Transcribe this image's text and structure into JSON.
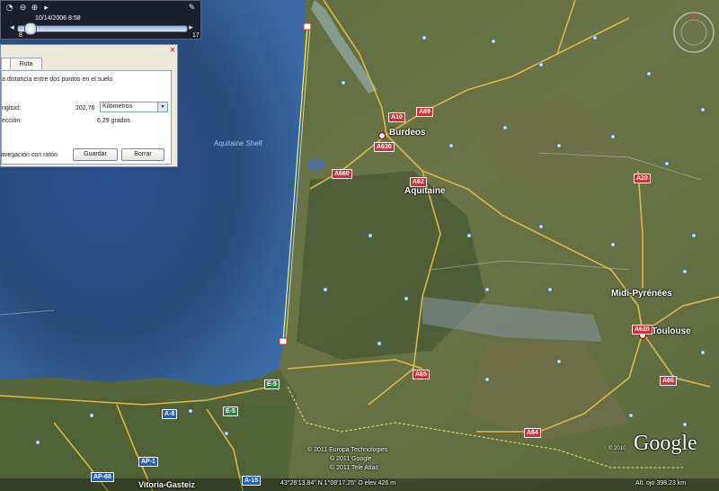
{
  "time_slider": {
    "date": "10/14/2006",
    "time": "8:58",
    "start_label": "8",
    "end_label": "17"
  },
  "ruler": {
    "tab_line": "",
    "tab_path": "Ruta",
    "description": "a distancia entre dos puntos en el suelo",
    "length_label": "ngitud:",
    "length_value": "202,76",
    "unit_selected": "Kilómetros",
    "heading_label": "ección:",
    "heading_value": "6,29 grados",
    "mouse_nav_label": "avegación con ratón",
    "save_label": "Guardar",
    "clear_label": "Borrar"
  },
  "map_labels": {
    "shelf": "Aquitaine Shelf",
    "bordeaux": "Burdeos",
    "aquitaine": "Aquitaine",
    "midi": "Midi-Pyrénées",
    "toulouse": "Toulouse",
    "vitoria": "Vitoria-Gasteiz"
  },
  "road_shields": {
    "a10": "A10",
    "a89": "A89",
    "a630": "A630",
    "a660": "A660",
    "a62": "A62",
    "a20": "A20",
    "a65": "A65",
    "a620": "A620",
    "a66": "A66",
    "a64": "A64",
    "e5": "E-5",
    "e5b": "E-5",
    "a8": "A-8",
    "ap1": "AP-1",
    "ap68": "AP-68",
    "a15": "A-15"
  },
  "copyright": {
    "line1": "© 2011 Europa Technologies",
    "line2": "© 2011 Google",
    "line3": "© 2011 Tele Atlas"
  },
  "status": {
    "coords": "43°26'13.84\" N   1°08'17.25\" O  elev   426 m",
    "eye_alt": "Alt. ojo  398.23 km"
  },
  "logo": {
    "text": "Google",
    "year": "© 2010"
  },
  "colors": {
    "ocean": "#2c4f86",
    "land": "#566b3a",
    "road": "#e8c14a",
    "measure_line": "#f4f08a"
  }
}
